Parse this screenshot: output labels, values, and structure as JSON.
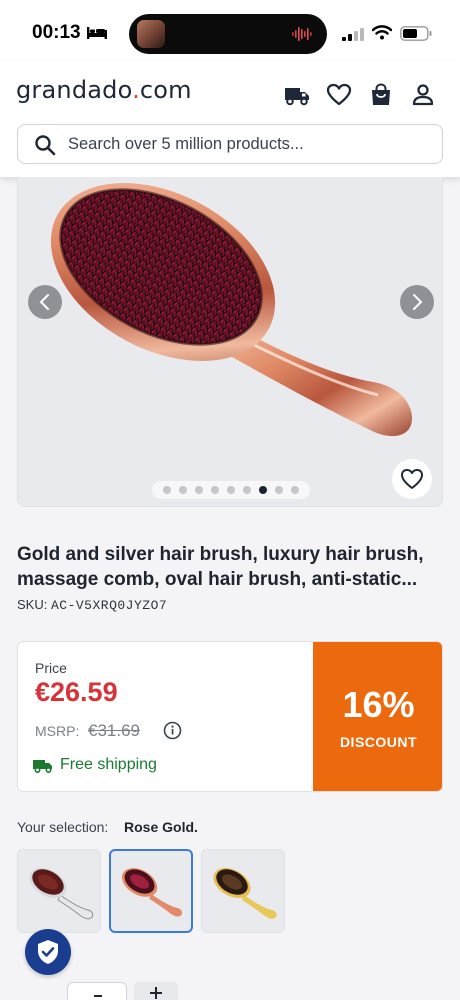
{
  "status_bar": {
    "time": "00:13"
  },
  "header": {
    "logo_main": "grandado",
    "logo_dot": ".",
    "logo_tld": "com",
    "icons": [
      "truck-icon",
      "heart-icon",
      "shopping-bag-icon",
      "user-icon"
    ]
  },
  "search": {
    "placeholder": "Search over 5 million products..."
  },
  "gallery": {
    "image_count": 9,
    "active_index": 7
  },
  "product": {
    "title": "Gold and silver hair brush, luxury hair brush, massage comb, oval hair brush, anti-static...",
    "sku_label": "SKU:",
    "sku": "AC-V5XRQ0JYZO7"
  },
  "price": {
    "label": "Price",
    "value": "€26.59",
    "msrp_label": "MSRP:",
    "msrp_value": "€31.69",
    "shipping": "Free shipping",
    "discount_pct": "16%",
    "discount_label": "DISCOUNT"
  },
  "selection": {
    "label": "Your selection:",
    "value": "Rose Gold.",
    "variants": [
      {
        "name": "Silver",
        "selected": false
      },
      {
        "name": "Rose Gold",
        "selected": true
      },
      {
        "name": "Gold",
        "selected": false
      }
    ]
  },
  "colors": {
    "price_red": "#d7333a",
    "discount_orange": "#ec6a0d",
    "shipping_green": "#1a7a32",
    "selected_border": "#3b7be0",
    "trust_badge": "#1b3d8f"
  }
}
